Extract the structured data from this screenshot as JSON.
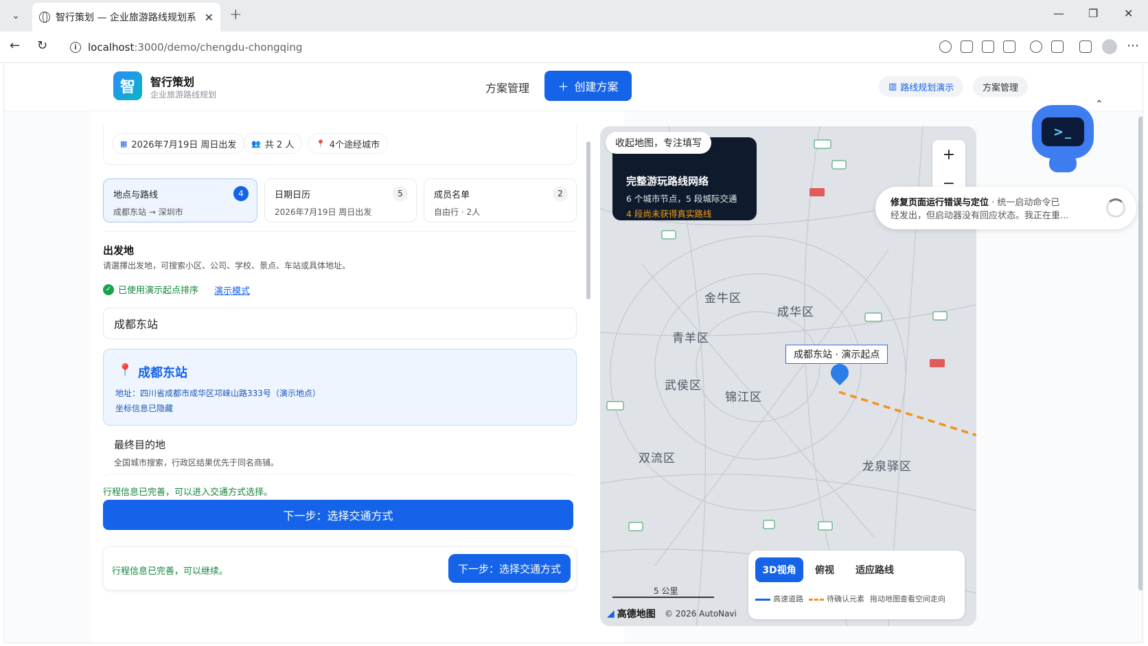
{
  "browser": {
    "tab_title": "智行策划 — 企业旅游路线规划系统",
    "url_host": "localhost",
    "url_path": ":3000/demo/chengdu-chongqing"
  },
  "header": {
    "brand_name": "智行策划",
    "brand_sub": "企业旅游路线规划",
    "logo_char": "智",
    "nav_manage": "方案管理",
    "create_label": "创建方案",
    "demo_pill": "路线规划演示",
    "manage_pill": "方案管理"
  },
  "summary": {
    "date": "2026年7月19日 周日出发",
    "people": "共 2 人",
    "cities": "4个途经城市"
  },
  "steps": [
    {
      "title": "地点与路线",
      "sub": "成都东站 → 深圳市",
      "count": "4"
    },
    {
      "title": "日期日历",
      "sub": "2026年7月19日 周日出发",
      "count": "5"
    },
    {
      "title": "成员名单",
      "sub": "自由行 · 2人",
      "count": "2"
    }
  ],
  "origin": {
    "title": "出发地",
    "desc": "请選擇出发地，可搜索小区、公司、学校、景点、车站或具体地址。",
    "demo_status": "已使用演示起点排序",
    "demo_link": "演示模式",
    "input_value": "成都东站",
    "place_name": "成都东站",
    "place_address": "地址：四川省成都市成华区邛崃山路333号（演示地点）",
    "place_coord": "坐标信息已隐藏"
  },
  "destination": {
    "title": "最终目的地",
    "desc": "全国城市搜索，行政区结果优先于同名商铺。"
  },
  "footer": {
    "done_text": "行程信息已完善，可以进入交通方式选择。",
    "next_label": "下一步：选择交通方式",
    "bottom_text": "行程信息已完善，可以继续。",
    "bottom_btn": "下一步：选择交通方式"
  },
  "map": {
    "collapse_label": "收起地图，专注填写",
    "network_title": "完整游玩路线网络",
    "network_sub": "6 个城市节点，5 段城际交通",
    "network_warn": "4 段尚未获得真实路线",
    "zoom_in": "+",
    "zoom_out": "−",
    "districts": [
      "金牛区",
      "成华区",
      "青羊区",
      "武侯区",
      "锦江区",
      "双流区",
      "龙泉驿区"
    ],
    "origin_tag": "成都东站 · 演示起点",
    "scale": "5 公里",
    "provider": "高德地图",
    "copyright": "© 2026 AutoNavi",
    "view_3d": "3D视角",
    "view_top": "俯视",
    "view_fit": "适应路线",
    "legend_road": "高速道路",
    "legend_pending": "待确认元素",
    "legend_hint": "拖动地图查看空间走向"
  },
  "assistant": {
    "face": ">_",
    "title": "修复页面运行错误与定位",
    "line1_rest": " · 统一启动命令已",
    "line2": "经发出，但启动器没有回应状态。我正在重..."
  },
  "colors": {
    "primary": "#1463e8",
    "success": "#14853b",
    "warning": "#f59e0b",
    "route_pending": "#f5901e"
  }
}
